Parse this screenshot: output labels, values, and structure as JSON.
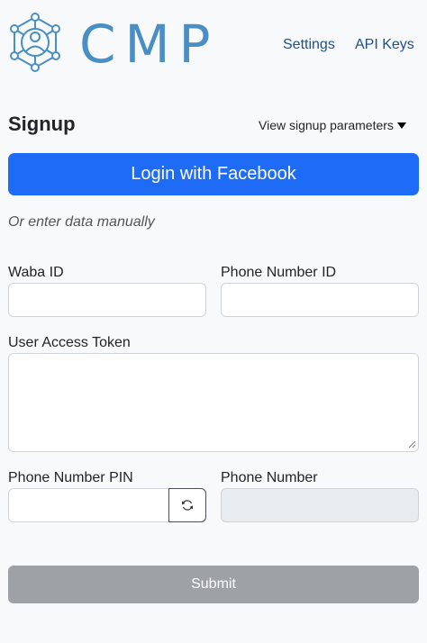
{
  "header": {
    "logo_text": "CMP",
    "nav": [
      {
        "label": "Settings"
      },
      {
        "label": "API Keys"
      }
    ]
  },
  "signup": {
    "title": "Signup",
    "params_toggle_label": "View signup parameters",
    "facebook_button_label": "Login with Facebook",
    "manual_hint": "Or enter data manually"
  },
  "form": {
    "waba_id": {
      "label": "Waba ID",
      "value": ""
    },
    "phone_number_id": {
      "label": "Phone Number ID",
      "value": ""
    },
    "user_access_token": {
      "label": "User Access Token",
      "value": ""
    },
    "phone_number_pin": {
      "label": "Phone Number PIN",
      "value": ""
    },
    "phone_number": {
      "label": "Phone Number",
      "value": ""
    },
    "submit_label": "Submit"
  },
  "colors": {
    "brand": "#4a8ec6",
    "facebook_blue": "#1e6cf6",
    "submit_disabled": "#9ea1a6"
  },
  "icons": {
    "logo": "network-person-icon",
    "refresh": "refresh-icon",
    "caret": "caret-down-icon"
  }
}
